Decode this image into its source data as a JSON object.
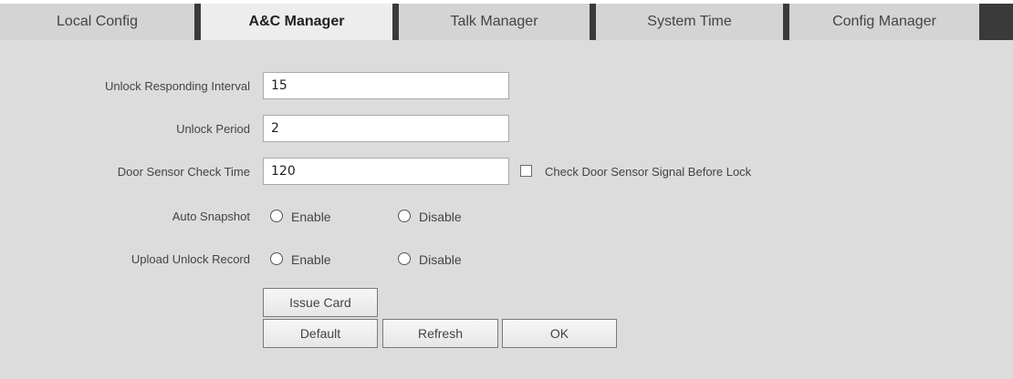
{
  "tabs": [
    {
      "label": "Local Config",
      "active": false
    },
    {
      "label": "A&C Manager",
      "active": true
    },
    {
      "label": "Talk Manager",
      "active": false
    },
    {
      "label": "System Time",
      "active": false
    },
    {
      "label": "Config Manager",
      "active": false
    }
  ],
  "form": {
    "unlock_interval": {
      "label": "Unlock Responding Interval",
      "value": "15"
    },
    "unlock_period": {
      "label": "Unlock Period",
      "value": "2"
    },
    "door_sensor": {
      "label": "Door Sensor Check Time",
      "value": "120",
      "checkbox_label": "Check Door Sensor Signal Before Lock",
      "checked": false
    },
    "auto_snapshot": {
      "label": "Auto Snapshot",
      "enable": "Enable",
      "disable": "Disable"
    },
    "upload_unlock_record": {
      "label": "Upload Unlock Record",
      "enable": "Enable",
      "disable": "Disable"
    }
  },
  "buttons": {
    "issue_card": "Issue Card",
    "default": "Default",
    "refresh": "Refresh",
    "ok": "OK"
  },
  "colors": {
    "panel_bg": "#dcdcdc",
    "tab_bg": "#d4d4d4",
    "tab_active_bg": "#ededed",
    "tab_separator": "#3a3a3a"
  },
  "icons": {
    "checkbox": "checkbox-icon",
    "radio": "radio-icon"
  }
}
